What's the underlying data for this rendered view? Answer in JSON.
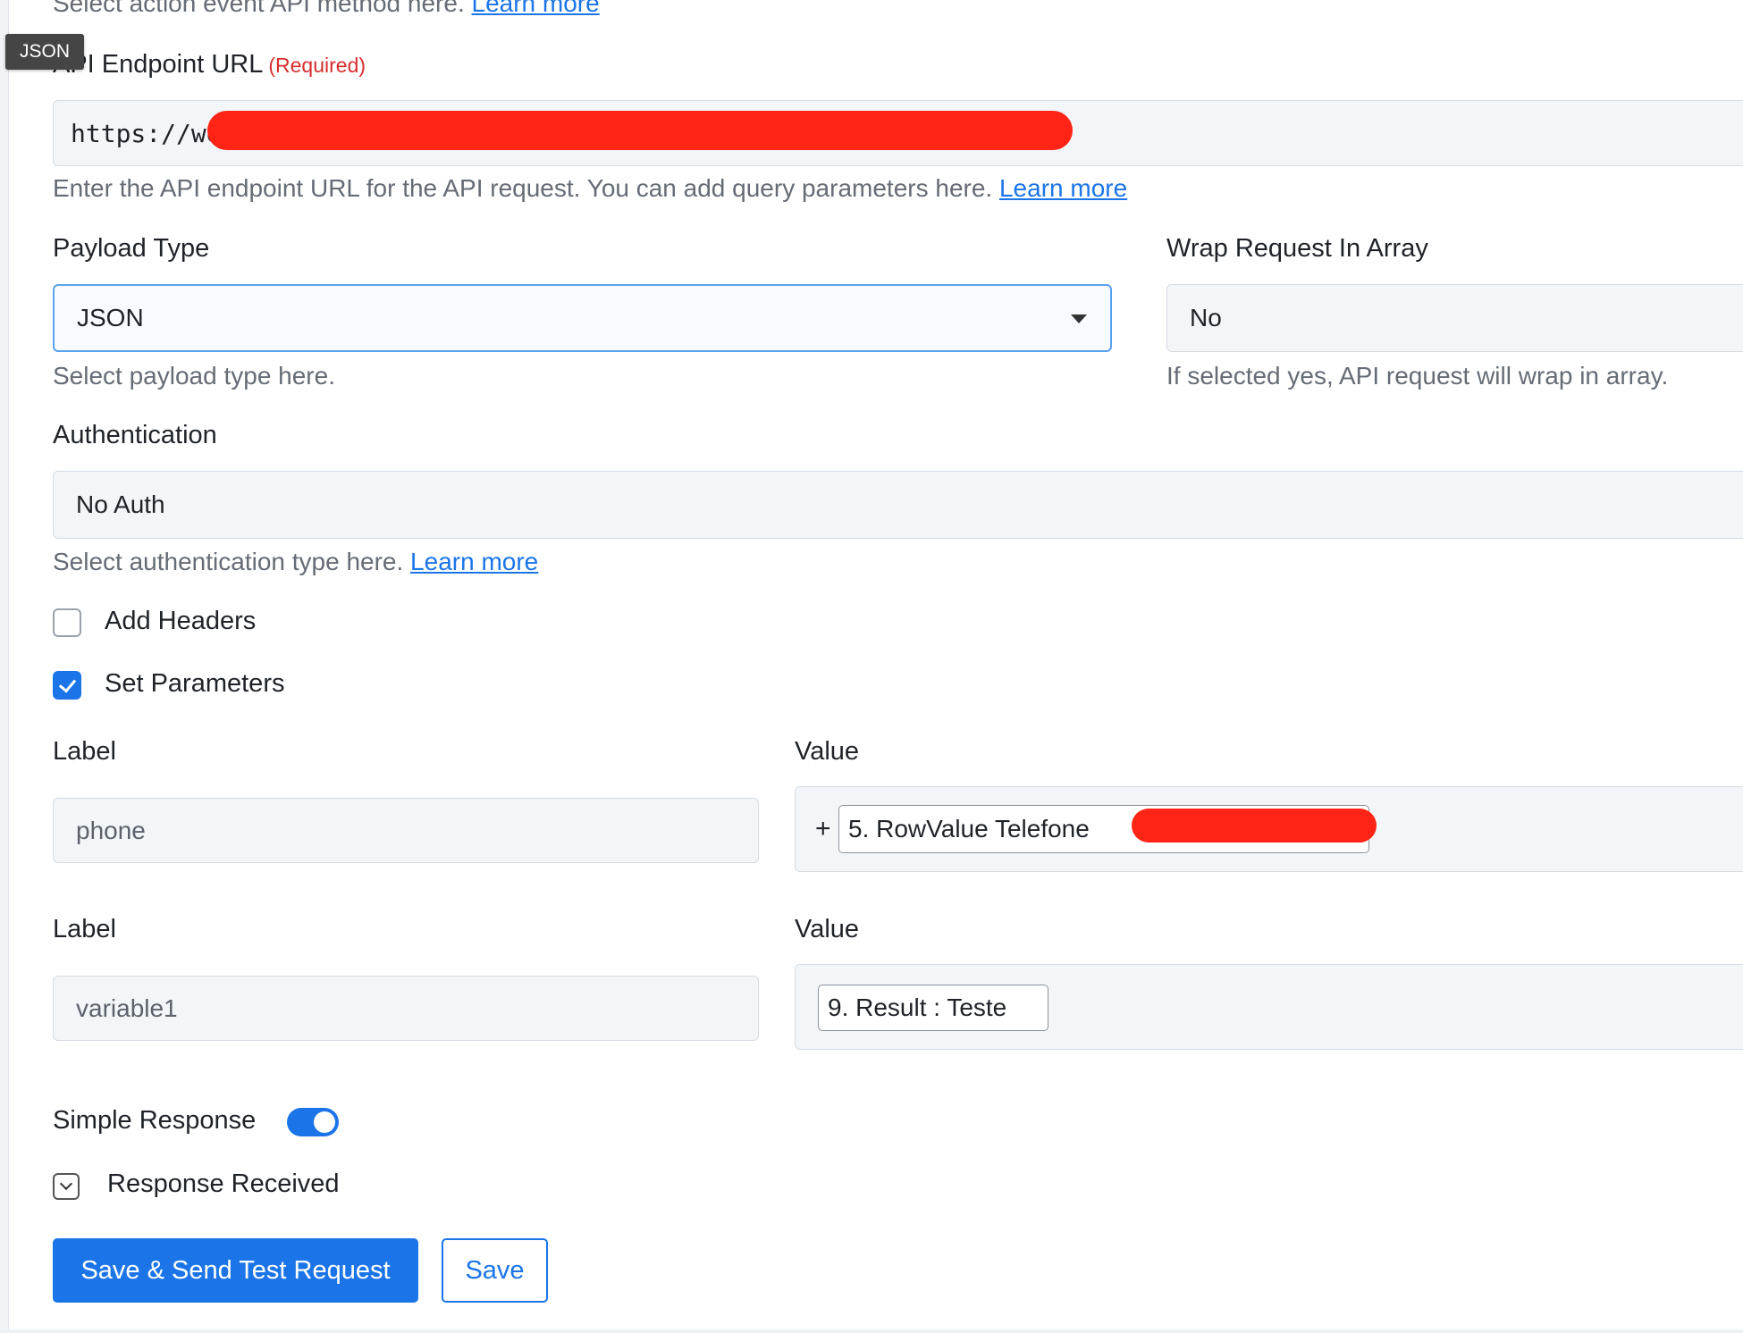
{
  "top_hint": {
    "text": "Select action event API method here.",
    "link": "Learn more"
  },
  "tooltip": "JSON",
  "endpoint": {
    "label": "API Endpoint URL",
    "required": "(Required)",
    "value": "https://wel",
    "hint": "Enter the API endpoint URL for the API request. You can add query parameters here.",
    "link": "Learn more"
  },
  "payload": {
    "label": "Payload Type",
    "value": "JSON",
    "hint": "Select payload type here."
  },
  "wrap": {
    "label": "Wrap Request In Array",
    "value": "No",
    "hint": "If selected yes, API request will wrap in array."
  },
  "auth": {
    "label": "Authentication",
    "value": "No Auth",
    "hint": "Select authentication type here.",
    "link": "Learn more"
  },
  "add_headers": {
    "label": "Add Headers",
    "checked": false
  },
  "set_parameters": {
    "label": "Set Parameters",
    "checked": true
  },
  "params": [
    {
      "label_title": "Label",
      "label_value": "phone",
      "value_title": "Value",
      "prefix": "+",
      "chip": "5. RowValue Telefone"
    },
    {
      "label_title": "Label",
      "label_value": "variable1",
      "value_title": "Value",
      "chip": "9. Result : Teste"
    }
  ],
  "simple_response": {
    "label": "Simple Response",
    "on": true
  },
  "response_received": {
    "label": "Response Received"
  },
  "buttons": {
    "send": "Save & Send Test Request",
    "save": "Save"
  },
  "colors": {
    "accent": "#1b75e8",
    "required": "#d92e2e",
    "redaction": "#ff2415"
  }
}
